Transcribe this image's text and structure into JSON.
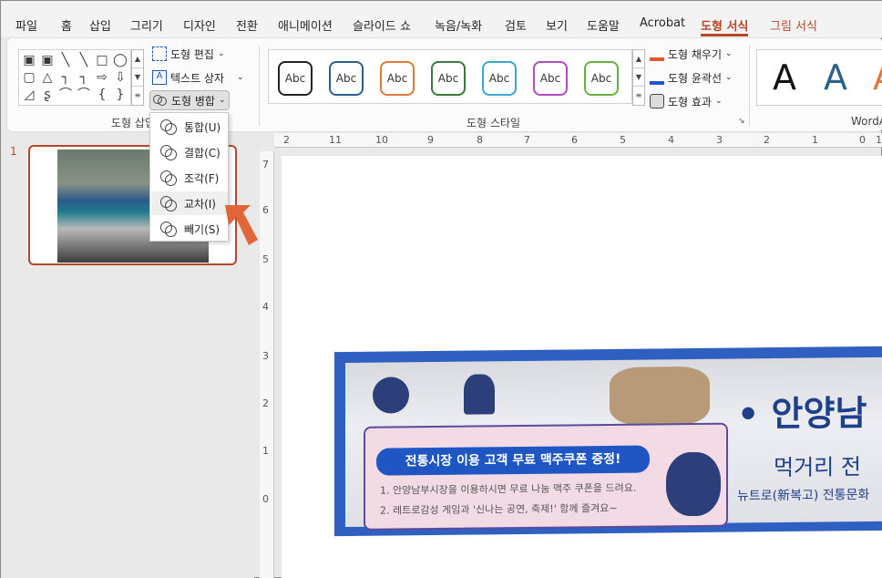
{
  "tabs": [
    "파일",
    "홈",
    "삽입",
    "그리기",
    "디자인",
    "전환",
    "애니메이션",
    "슬라이드 쇼",
    "녹음/녹화",
    "검토",
    "보기",
    "도움말",
    "Acrobat",
    "도형 서식",
    "그림 서식"
  ],
  "ribbon": {
    "insert_shapes_group_label": "도형 삽입",
    "edit_shape_label": "도형 편집",
    "text_box_label": "텍스트 상자",
    "merge_shapes_label": "도형 병합",
    "shape_styles_group_label": "도형 스타일",
    "style_sample": "Abc",
    "style_colors": [
      "#222222",
      "#2a6189",
      "#e07a3a",
      "#3a7a3a",
      "#3aa6d6",
      "#b04cc0",
      "#6ab040"
    ],
    "shape_fill_label": "도형 채우기",
    "shape_outline_label": "도형 윤곽선",
    "shape_effects_label": "도형 효과",
    "wordart_group_label": "WordArt",
    "wordart_sample": "A"
  },
  "merge_menu": [
    {
      "label": "통합(U)",
      "icon": "union-icon"
    },
    {
      "label": "결합(C)",
      "icon": "combine-icon"
    },
    {
      "label": "조각(F)",
      "icon": "fragment-icon"
    },
    {
      "label": "교차(I)",
      "icon": "intersect-icon"
    },
    {
      "label": "빼기(S)",
      "icon": "subtract-icon"
    }
  ],
  "slide_pane": {
    "slide_number": "1"
  },
  "ruler_top": [
    "2",
    "11",
    "10",
    "9",
    "8",
    "7",
    "6",
    "5",
    "4",
    "3",
    "2",
    "1",
    "0",
    "1"
  ],
  "ruler_left": [
    "7",
    "6",
    "5",
    "4",
    "3",
    "2",
    "1",
    "0"
  ],
  "banner": {
    "pink_title": "전통시장 이용 고객 무료 맥주쿠폰 증정!",
    "line1": "1. 안양남부시장을 이용하시면 무료 나눔 맥주 쿠폰을 드려요.",
    "line2": "2. 레트로감성 게임과 '신나는 공연, 축제!' 함께 즐겨요~",
    "title": "• 안양남",
    "subtitle": "먹거리 전",
    "subtitle2": "뉴트로(新복고) 전통문화"
  },
  "colors": {
    "accent": "#b7472a",
    "banner_blue": "#2f5fc0"
  }
}
